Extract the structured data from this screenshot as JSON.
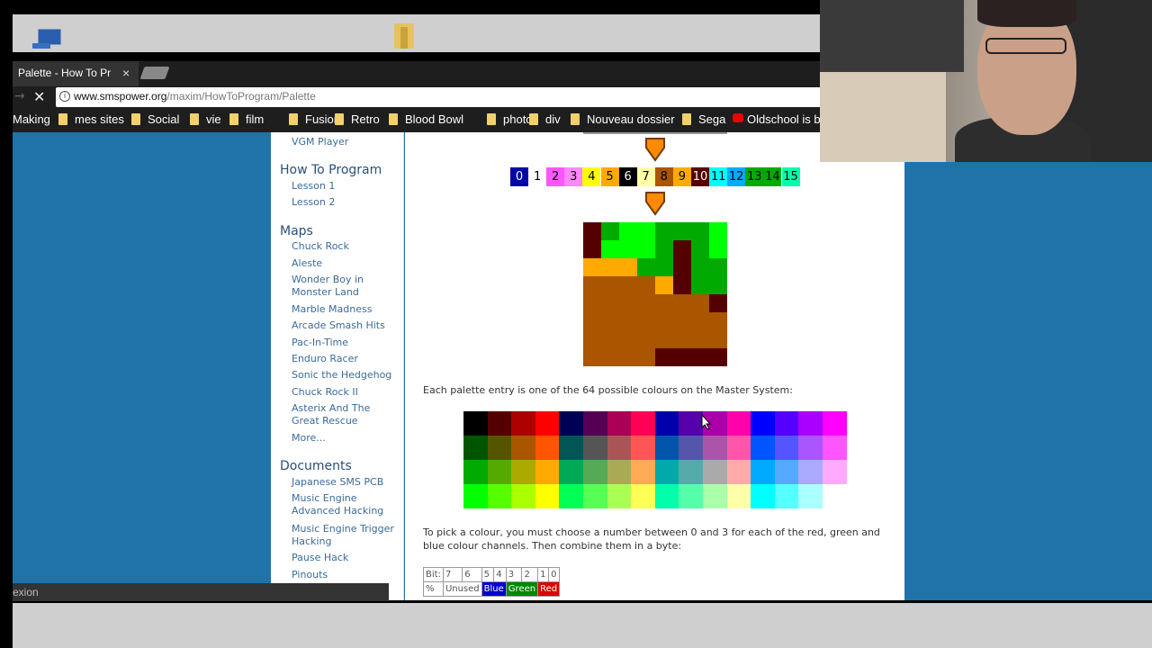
{
  "browser": {
    "tab_title": "Palette - How To Pr",
    "tab_close": "×",
    "url_host": "www.smspower.org",
    "url_path": "/maxim/HowToProgram/Palette",
    "bookmarks": [
      "Making",
      "mes sites",
      "Social",
      "vie",
      "film",
      "Fusion",
      "Retro",
      "Blood Bowl",
      "photo",
      "div",
      "Nouveau dossier",
      "Sega",
      "Oldschool is b"
    ],
    "status": "exion"
  },
  "sidebar": {
    "top_item": "VGM Player",
    "sections": [
      {
        "heading": "How To Program",
        "items": [
          "Lesson 1",
          "Lesson 2"
        ]
      },
      {
        "heading": "Maps",
        "items": [
          "Chuck Rock",
          "Aleste",
          "Wonder Boy in Monster Land",
          "Marble Madness",
          "Arcade Smash Hits",
          "Pac-In-Time",
          "Enduro Racer",
          "Sonic the Hedgehog",
          "Chuck Rock II",
          "Asterix And The Great Rescue",
          "More..."
        ]
      },
      {
        "heading": "Documents",
        "items": [
          "Japanese SMS PCB",
          "Music Engine Advanced Hacking",
          "Music Engine Trigger Hacking",
          "Pause Hack",
          "Pinouts"
        ]
      }
    ]
  },
  "content": {
    "palette_numbers": [
      "0",
      "1",
      "2",
      "3",
      "4",
      "5",
      "6",
      "7",
      "8",
      "9",
      "10",
      "11",
      "12",
      "13",
      "14",
      "15"
    ],
    "palette_colors": [
      "#0000aa",
      "#ffffff",
      "#ff55ff",
      "#ff88ff",
      "#ffff00",
      "#ffaa00",
      "#000000",
      "#ffffaa",
      "#aa5500",
      "#ffaa00",
      "#550000",
      "#00ffff",
      "#00aaff",
      "#00aa00",
      "#00aa00",
      "#00ffaa"
    ],
    "palette_text_colors": [
      "#ffffff",
      "#000000",
      "#000000",
      "#000000",
      "#000000",
      "#000000",
      "#ffffff",
      "#000000",
      "#000000",
      "#000000",
      "#ffffff",
      "#000000",
      "#000000",
      "#000000",
      "#000000",
      "#000000"
    ],
    "intro": "Each palette entry is one of the 64 possible colours on the Master System:",
    "pick_text": "To pick a colour, you must choose a number between 0 and 3 for each of the red, green and blue colour channels. Then combine them in a byte:",
    "bit_header": [
      "Bit:",
      "7",
      "6",
      "5",
      "4",
      "3",
      "2",
      "1",
      "0"
    ],
    "bit_row": [
      "%",
      "Unused",
      "Blue",
      "Green",
      "Red"
    ]
  }
}
